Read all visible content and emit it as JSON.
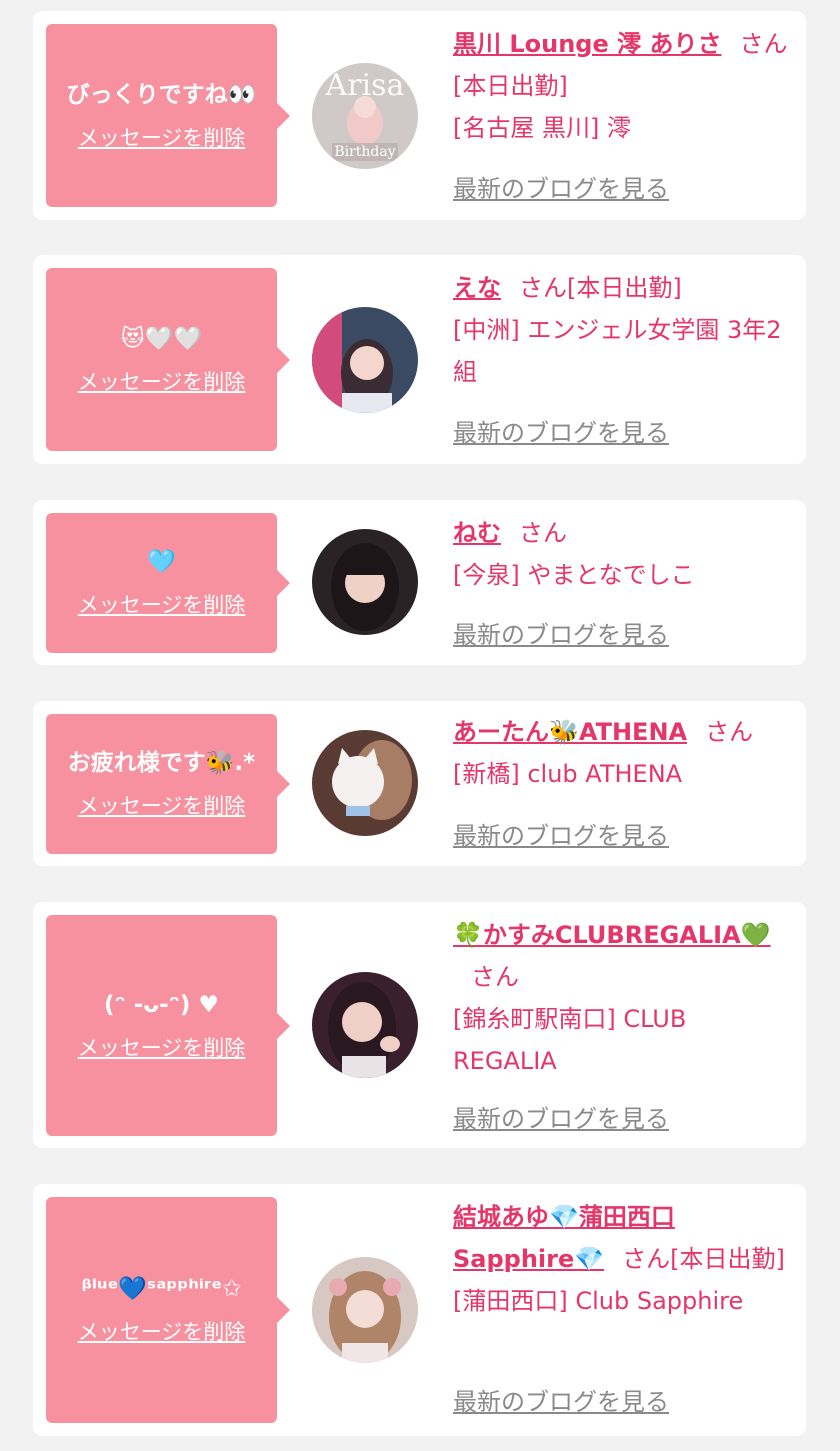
{
  "san_label": "さん",
  "cards": [
    {
      "message": "びっくりですね👀",
      "delete_label": "メッセージを削除",
      "name": "黒川 Lounge 澪 ありさ",
      "status": "[本日出勤]",
      "shop": "[名古屋 黒川] 澪",
      "blog_label": "最新のブログを見る",
      "avatar_text": "Arisa"
    },
    {
      "message": "😻🤍🤍",
      "delete_label": "メッセージを削除",
      "name": "えな",
      "status": "[本日出勤]",
      "shop": "[中洲] エンジェル女学園 3年2組",
      "blog_label": "最新のブログを見る"
    },
    {
      "message": "🩵",
      "delete_label": "メッセージを削除",
      "name": "ねむ",
      "status": "",
      "shop": "[今泉] やまとなでしこ",
      "blog_label": "最新のブログを見る"
    },
    {
      "message": "お疲れ様です🐝.*",
      "delete_label": "メッセージを削除",
      "name": "あーたん🐝ATHENA",
      "status": "",
      "shop": "[新橋] club ATHENA",
      "blog_label": "最新のブログを見る"
    },
    {
      "message": "(ᵔ -ᴗ-ᵔ) ♥",
      "delete_label": "メッセージを削除",
      "name": "🍀かすみCLUBREGALIA💚",
      "status": "",
      "shop": "[錦糸町駅南口] CLUB REGALIA",
      "blog_label": "最新のブログを見る"
    },
    {
      "message": "ᵝˡᵘᵉ💙ˢᵃᵖᵖʰⁱʳᵉ✩",
      "delete_label": "メッセージを削除",
      "name": "結城あゆ💎蒲田西口Sapphire💎",
      "status": "[本日出勤]",
      "shop": "[蒲田西口] Club Sapphire",
      "blog_label": "最新のブログを見る"
    }
  ]
}
